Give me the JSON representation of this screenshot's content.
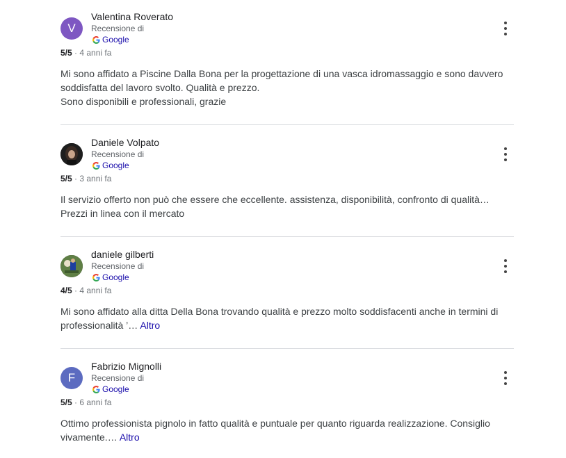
{
  "reviews": [
    {
      "author": "Valentina Roverato",
      "avatar_initial": "V",
      "avatar_color": "#7e57c2",
      "avatar_type": "letter",
      "source_label": "Recensione di",
      "source_name": "Google",
      "rating": "5/5",
      "time": "4 anni fa",
      "lines": [
        "Mi sono affidato a Piscine Dalla Bona per la progettazione di una vasca idromassaggio e sono davvero",
        "soddisfatta del lavoro svolto. Qualità e prezzo.",
        "Sono disponibili e professionali, grazie"
      ],
      "more_label": ""
    },
    {
      "author": "Daniele Volpato",
      "avatar_initial": "",
      "avatar_color": "#2b2b2b",
      "avatar_type": "photo",
      "source_label": "Recensione di",
      "source_name": "Google",
      "rating": "5/5",
      "time": "3 anni fa",
      "lines": [
        "Il servizio offerto non può che essere che eccellente. assistenza, disponibilità, confronto di qualità…",
        "Prezzi in linea con il mercato"
      ],
      "more_label": ""
    },
    {
      "author": "daniele gilberti",
      "avatar_initial": "",
      "avatar_color": "#6b8e4e",
      "avatar_type": "photo",
      "source_label": "Recensione di",
      "source_name": "Google",
      "rating": "4/5",
      "time": "4 anni fa",
      "lines": [
        "Mi sono affidato alla ditta Della Bona trovando qualità e prezzo molto soddisfacenti anche in termini di",
        "professionalità ’…"
      ],
      "more_label": "Altro"
    },
    {
      "author": "Fabrizio Mignolli",
      "avatar_initial": "F",
      "avatar_color": "#5c6bc0",
      "avatar_type": "letter",
      "source_label": "Recensione di",
      "source_name": "Google",
      "rating": "5/5",
      "time": "6 anni fa",
      "lines": [
        "Ottimo professionista pignolo in fatto qualità e puntuale per quanto riguarda realizzazione. Consiglio",
        "vivamente.…"
      ],
      "more_label": "Altro"
    }
  ],
  "icons": {
    "more": "more-vert-icon",
    "google": "google-g-icon"
  }
}
